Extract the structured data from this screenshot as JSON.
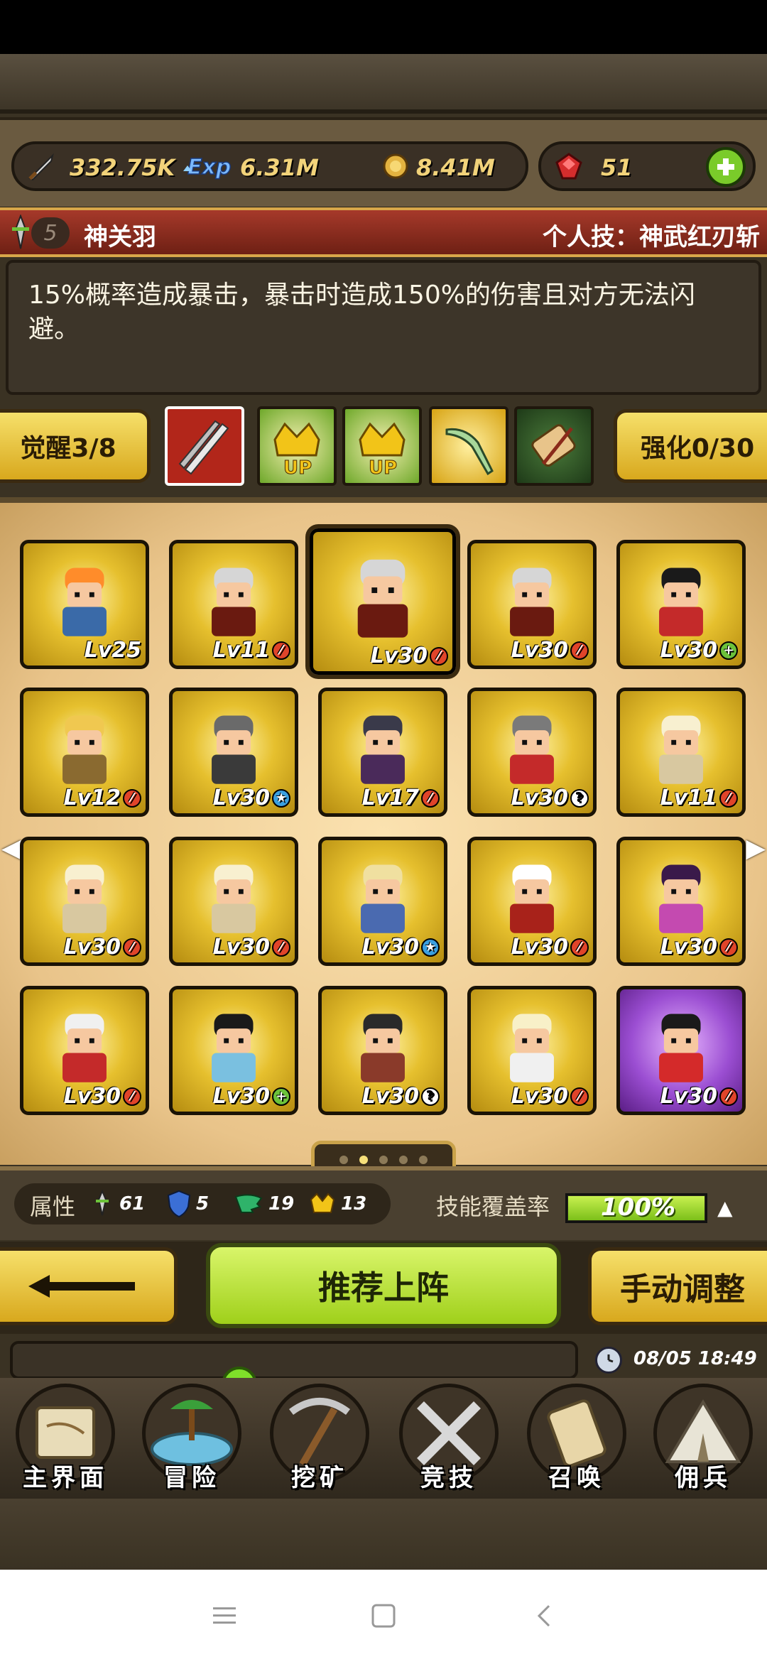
{
  "resources": {
    "attack": "332.75K",
    "exp": "6.31M",
    "gold": "8.41M",
    "gems": "51"
  },
  "hero": {
    "rank": "5",
    "name": "神关羽",
    "skill_title": "个人技：神武红刃斩",
    "description": "15%概率造成暴击，暴击时造成150%的伤害且对方无法闪避。"
  },
  "awaken": {
    "awaken_label": "觉醒3/8",
    "enhance_label": "强化0/30",
    "skill_icons": [
      "twin-blades-icon",
      "crown-up-icon",
      "crown-up-icon",
      "glaive-icon",
      "scroll-icon"
    ]
  },
  "cards": [
    {
      "level": "Lv25",
      "badge": ""
    },
    {
      "level": "Lv11",
      "badge": "red"
    },
    {
      "level": "Lv30",
      "badge": "red"
    },
    {
      "level": "Lv30",
      "badge": "red"
    },
    {
      "level": "Lv30",
      "badge": "green"
    },
    {
      "level": "Lv12",
      "badge": "red"
    },
    {
      "level": "Lv30",
      "badge": "blue"
    },
    {
      "level": "Lv17",
      "badge": "red"
    },
    {
      "level": "Lv30",
      "badge": "question"
    },
    {
      "level": "Lv11",
      "badge": "red"
    },
    {
      "level": "Lv30",
      "badge": "red"
    },
    {
      "level": "Lv30",
      "badge": "red"
    },
    {
      "level": "Lv30",
      "badge": "blue"
    },
    {
      "level": "Lv30",
      "badge": "red"
    },
    {
      "level": "Lv30",
      "badge": "red"
    },
    {
      "level": "Lv30",
      "badge": "red"
    },
    {
      "level": "Lv30",
      "badge": "green"
    },
    {
      "level": "Lv30",
      "badge": "question"
    },
    {
      "level": "Lv30",
      "badge": "red"
    },
    {
      "level": "Lv30",
      "badge": "red"
    }
  ],
  "pager": {
    "pages": 5,
    "current": 2
  },
  "stats": {
    "label": "属性",
    "sword": "61",
    "shield": "5",
    "wing": "19",
    "crown": "13",
    "coverage_label": "技能覆盖率",
    "coverage_value": "100%",
    "coverage_fraction": 1.0
  },
  "actions": {
    "back": "⟵",
    "recommend": "推荐上阵",
    "manual": "手动调整"
  },
  "clock": "08/05 18:49",
  "nav": [
    {
      "label": "主界面",
      "icon": "map-scroll-icon"
    },
    {
      "label": "冒险",
      "icon": "island-icon"
    },
    {
      "label": "挖矿",
      "icon": "pickaxe-icon"
    },
    {
      "label": "竞技",
      "icon": "crossed-swords-icon"
    },
    {
      "label": "召唤",
      "icon": "summon-scroll-icon"
    },
    {
      "label": "佣兵",
      "icon": "tent-icon"
    }
  ],
  "colors": {
    "gold": "#e6c02e",
    "green": "#9fd01a",
    "red": "#a6392a",
    "purple": "#9b4ed2"
  }
}
